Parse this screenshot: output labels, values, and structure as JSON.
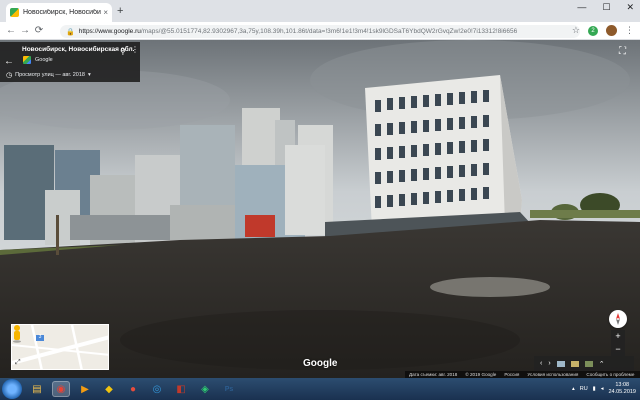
{
  "browser": {
    "tab_title": "Новосибирск, Новосибирская обл.",
    "tab_close": "×",
    "new_tab": "+",
    "window_controls": {
      "minimize": "—",
      "maximize": "☐",
      "close": "✕"
    },
    "nav": {
      "back": "←",
      "forward": "→",
      "reload": "⟳"
    },
    "url_host": "https://www.google.ru",
    "url_path": "/maps/@55.0151774,82.9302967,3a,75y,108.39h,101.86t/data=!3m6!1e1!3m4!1sk9lGDSaT6YbdQW2rGvqZw!2e0!7i13312!8i6656",
    "star": "☆",
    "extension_badge": "2",
    "menu": "⋮"
  },
  "streetview": {
    "back_arrow": "←",
    "place_title": "Новосибирск, Новосибирская обл.",
    "source": "Google",
    "pin": "⚲",
    "more": "⋮",
    "timeline": "Просмотр улиц — авг. 2018",
    "clock_glyph": "◷",
    "timeline_caret": "▾",
    "fullscreen": "⛶",
    "google_watermark": "Google",
    "minimap_expand": "⤢",
    "minimap_badge": "3",
    "zoom_in": "+",
    "zoom_out": "−",
    "prev": "‹",
    "next": "›",
    "expand_up": "⌃",
    "attribution": {
      "capture_date": "Дата съемки: авг. 2018",
      "copyright": "© 2019 Google",
      "region": "Россия",
      "terms": "Условия использования",
      "report": "Сообщить о проблеме"
    }
  },
  "taskbar": {
    "apps": [
      {
        "name": "explorer",
        "glyph": "▤",
        "color": "#f2c14e"
      },
      {
        "name": "chrome",
        "glyph": "◉",
        "color": "#e94235",
        "active": true
      },
      {
        "name": "media-player",
        "glyph": "▶",
        "color": "#f39c12"
      },
      {
        "name": "app-a",
        "glyph": "◆",
        "color": "#f1c40f"
      },
      {
        "name": "camera",
        "glyph": "●",
        "color": "#e74c3c"
      },
      {
        "name": "app-b",
        "glyph": "◎",
        "color": "#3498db"
      },
      {
        "name": "app-c",
        "glyph": "◧",
        "color": "#c0392b"
      },
      {
        "name": "app-d",
        "glyph": "◈",
        "color": "#2ecc71"
      },
      {
        "name": "photoshop",
        "glyph": "Ps",
        "color": "#2c5d8f"
      }
    ],
    "language": "RU",
    "time": "13:08",
    "date": "24.05.2019"
  }
}
